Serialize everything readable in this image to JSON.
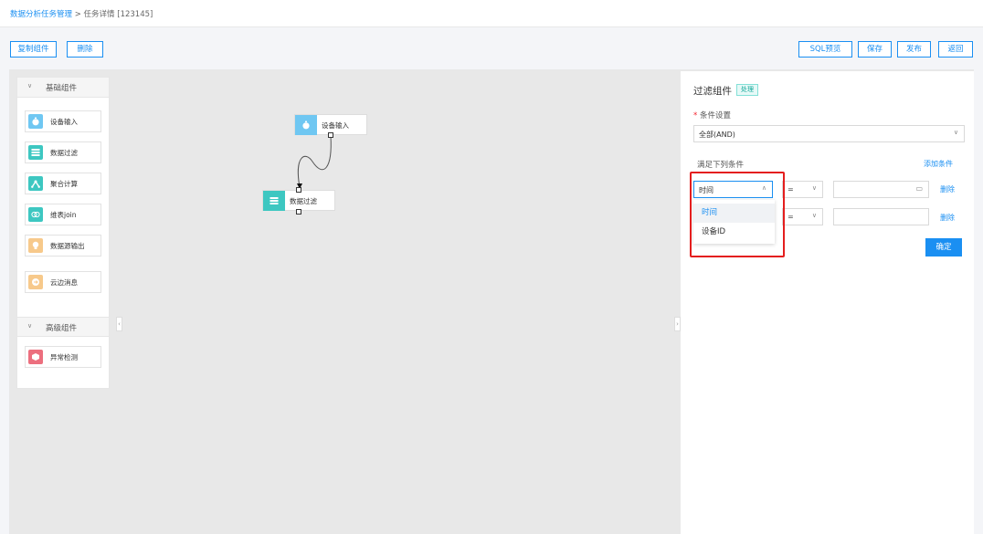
{
  "breadcrumb": {
    "root": "数据分析任务管理",
    "separator": ">",
    "current": "任务详情 [123145]"
  },
  "toolbar": {
    "copy_label": "复制组件",
    "delete_label": "删除",
    "sql_preview_label": "SQL预览",
    "save_label": "保存",
    "publish_label": "发布",
    "back_label": "返回"
  },
  "sidebar": {
    "basic_group": "基础组件",
    "basic_items": [
      {
        "label": "设备输入",
        "icon": "timer-icon",
        "color": "#6fc7f2"
      },
      {
        "label": "数据过滤",
        "icon": "list-icon",
        "color": "#3dc7c1"
      },
      {
        "label": "聚合计算",
        "icon": "branch-icon",
        "color": "#3dc7c1"
      },
      {
        "label": "维表join",
        "icon": "link-icon",
        "color": "#3dc7c1"
      },
      {
        "label": "数据源输出",
        "icon": "bulb-icon",
        "color": "#f7c98b"
      },
      {
        "label": "云边消息",
        "icon": "arrow-circle-icon",
        "color": "#f7c98b"
      }
    ],
    "advanced_group": "高级组件",
    "advanced_items": [
      {
        "label": "异常检测",
        "icon": "cube-icon",
        "color": "#ec6f7e"
      }
    ]
  },
  "canvas": {
    "nodes": [
      {
        "label": "设备输入",
        "icon": "timer-icon",
        "color": "#6fc7f2"
      },
      {
        "label": "数据过滤",
        "icon": "list-icon",
        "color": "#3dc7c1"
      }
    ]
  },
  "filter_panel": {
    "title": "过滤组件",
    "badge": "处理",
    "condition_label": "条件设置",
    "required_mark": "*",
    "condition_mode": "全部(AND)",
    "match_label": "满足下列条件",
    "add_condition": "添加条件",
    "rows": [
      {
        "field": "时间",
        "operator": "=",
        "value": "",
        "delete_label": "删除"
      },
      {
        "field": "",
        "operator": "=",
        "value": "",
        "delete_label": "删除"
      }
    ],
    "field_options": [
      "时间",
      "设备ID"
    ],
    "confirm_label": "确定"
  },
  "colors": {
    "accent": "#1a8ff2",
    "highlight": "#e41e1e"
  }
}
